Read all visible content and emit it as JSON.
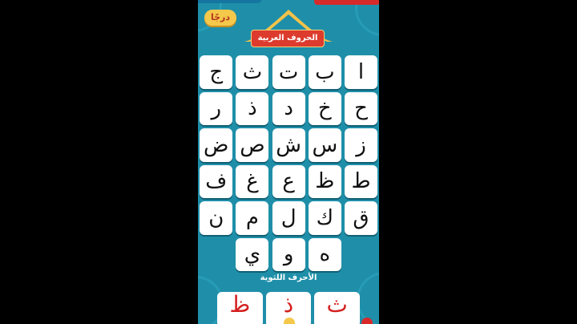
{
  "header": {
    "back_label": "درجًا",
    "title": "الحروف العربية"
  },
  "letters": [
    "ا",
    "ب",
    "ت",
    "ث",
    "ج",
    "ح",
    "خ",
    "د",
    "ذ",
    "ر",
    "ز",
    "س",
    "ش",
    "ص",
    "ض",
    "ط",
    "ظ",
    "ع",
    "غ",
    "ف",
    "ق",
    "ك",
    "ل",
    "م",
    "ن",
    "ه",
    "و",
    "ي"
  ],
  "section_label": "الأحرف اللثوية",
  "bottom_letters": [
    "ث",
    "ذ",
    "ظ"
  ],
  "colors": {
    "background": "#1f8fa9",
    "banner": "#dc3b2e",
    "back_button": "#f4c84a",
    "accent_letters": "#d41f1f"
  }
}
